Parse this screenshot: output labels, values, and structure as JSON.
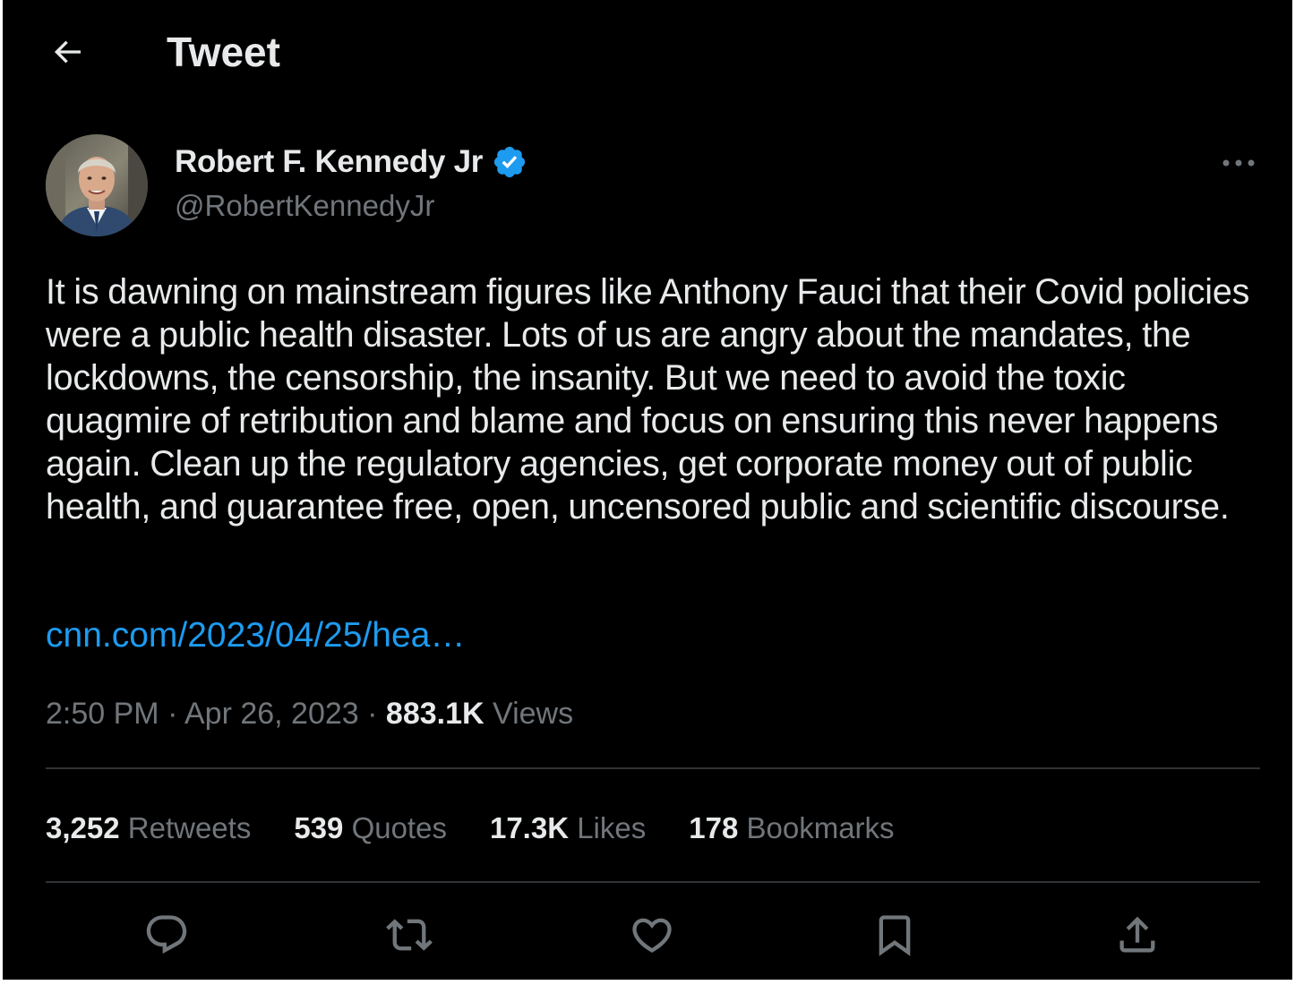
{
  "header": {
    "title": "Tweet",
    "back_icon": "arrow-left-icon"
  },
  "author": {
    "display_name": "Robert F. Kennedy Jr",
    "handle": "@RobertKennedyJr",
    "verified": true,
    "verified_color": "#1d9bf0"
  },
  "tweet": {
    "text": "It is dawning on mainstream figures like Anthony Fauci that their Covid policies were a public health disaster. Lots of us are angry about the mandates, the lockdowns, the censorship, the insanity. But we need to avoid the toxic quagmire of retribution and blame and focus on ensuring this never happens again. Clean up the regulatory agencies, get corporate money out of public health, and guarantee free, open, uncensored public and scientific discourse.",
    "link": "cnn.com/2023/04/25/hea…",
    "time": "2:50 PM",
    "separator": "·",
    "date": "Apr 26, 2023",
    "views_count": "883.1K",
    "views_label": "Views"
  },
  "stats": {
    "retweets": {
      "count": "3,252",
      "label": "Retweets"
    },
    "quotes": {
      "count": "539",
      "label": "Quotes"
    },
    "likes": {
      "count": "17.3K",
      "label": "Likes"
    },
    "bookmarks": {
      "count": "178",
      "label": "Bookmarks"
    }
  },
  "actions": [
    "reply-icon",
    "retweet-icon",
    "like-icon",
    "bookmark-icon",
    "share-icon"
  ],
  "colors": {
    "background": "#000000",
    "text_primary": "#e7e9ea",
    "text_secondary": "#71767b",
    "link": "#1d9bf0",
    "divider": "#2f3336"
  }
}
